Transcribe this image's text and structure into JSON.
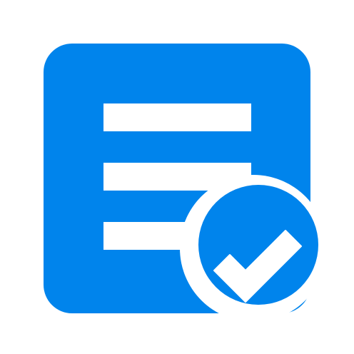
{
  "icon": {
    "name": "document-check-icon",
    "accent_color": "#0084EC",
    "background_color": "#FFFFFF",
    "parts": {
      "document": "document-icon",
      "text_lines": [
        "text-line-icon",
        "text-line-icon",
        "text-line-icon"
      ],
      "badge": "check-badge-icon",
      "checkmark": "checkmark-icon"
    }
  }
}
